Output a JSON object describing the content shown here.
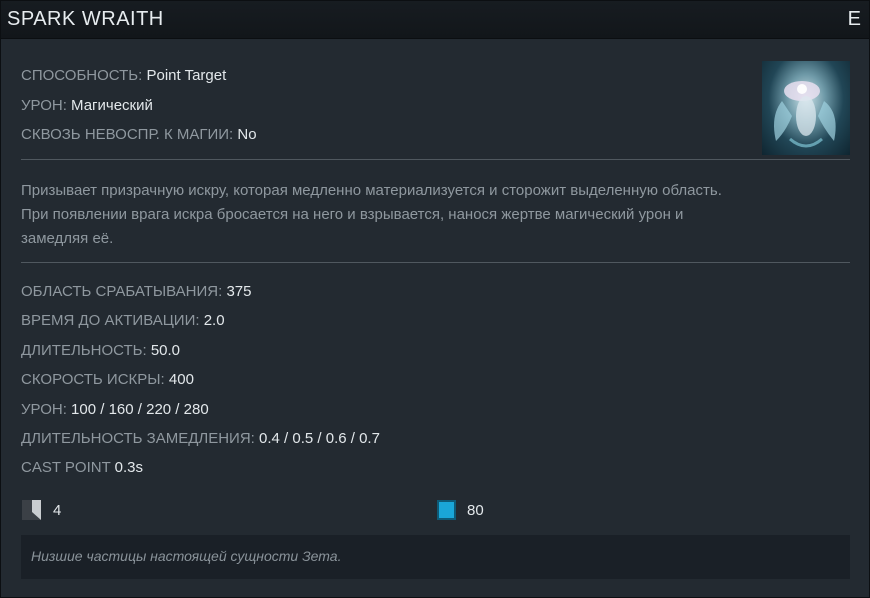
{
  "header": {
    "title": "SPARK WRAITH",
    "hotkey": "E"
  },
  "ability": {
    "behavior": {
      "label": "СПОСОБНОСТЬ:",
      "value": "Point Target"
    },
    "damage_type": {
      "label": "УРОН:",
      "value": "Магический"
    },
    "spell_immunity": {
      "label": "СКВОЗЬ НЕВОСПР. К МАГИИ:",
      "value": "No"
    },
    "portrait_icon": "spark-wraith-portrait"
  },
  "description": {
    "line1": "Призывает призрачную искру, которая медленно материализуется и сторожит выделенную область.",
    "line2": "При появлении врага искра бросается на него и взрывается, нанося жертве магический урон и",
    "line3": "замедляя её."
  },
  "stats": [
    {
      "label": "ОБЛАСТЬ СРАБАТЫВАНИЯ:",
      "value": "375"
    },
    {
      "label": "ВРЕМЯ ДО АКТИВАЦИИ:",
      "value": "2.0"
    },
    {
      "label": "ДЛИТЕЛЬНОСТЬ:",
      "value": "50.0"
    },
    {
      "label": "СКОРОСТЬ ИСКРЫ:",
      "value": "400"
    },
    {
      "label": "УРОН:",
      "value": "100 / 160 / 220 / 280"
    },
    {
      "label": "ДЛИТЕЛЬНОСТЬ ЗАМЕДЛЕНИЯ:",
      "value": "0.4 / 0.5 / 0.6 / 0.7"
    },
    {
      "label": "CAST POINT",
      "value": "0.3s"
    }
  ],
  "costs": {
    "cooldown": {
      "icon": "cooldown-icon",
      "value": "4"
    },
    "mana": {
      "icon": "mana-icon",
      "value": "80",
      "color": "#1aa6d8"
    }
  },
  "lore": "Низшие частицы настоящей сущности Зета."
}
